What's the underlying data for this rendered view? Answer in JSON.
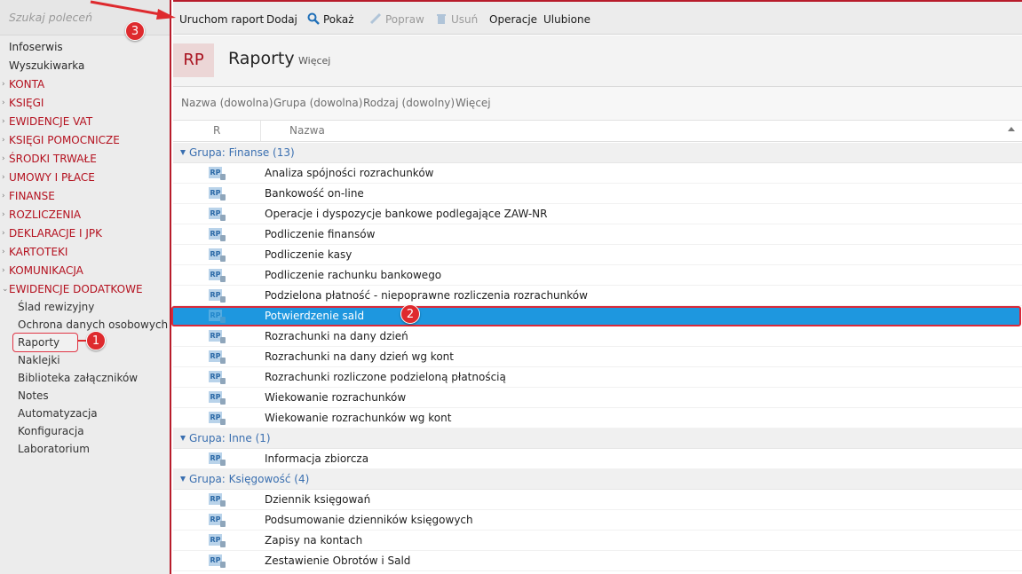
{
  "search": {
    "placeholder": "Szukaj poleceń"
  },
  "sidebar": {
    "items": [
      {
        "label": "Infoserwis",
        "kind": "plain"
      },
      {
        "label": "Wyszukiwarka",
        "kind": "plain"
      },
      {
        "label": "KONTA",
        "kind": "section"
      },
      {
        "label": "KSIĘGI",
        "kind": "section"
      },
      {
        "label": "EWIDENCJE VAT",
        "kind": "section"
      },
      {
        "label": "KSIĘGI POMOCNICZE",
        "kind": "section"
      },
      {
        "label": "ŚRODKI TRWAŁE",
        "kind": "section"
      },
      {
        "label": "UMOWY I PŁACE",
        "kind": "section"
      },
      {
        "label": "FINANSE",
        "kind": "section"
      },
      {
        "label": "ROZLICZENIA",
        "kind": "section"
      },
      {
        "label": "DEKLARACJE I JPK",
        "kind": "section"
      },
      {
        "label": "KARTOTEKI",
        "kind": "section"
      },
      {
        "label": "KOMUNIKACJA",
        "kind": "section"
      },
      {
        "label": "EWIDENCJE DODATKOWE",
        "kind": "section-open"
      }
    ],
    "subitems": [
      "Ślad rewizyjny",
      "Ochrona danych osobowych",
      "Raporty",
      "Naklejki",
      "Biblioteka załączników",
      "Notes",
      "Automatyzacja",
      "Konfiguracja",
      "Laboratorium"
    ]
  },
  "toolbar": {
    "run_label": "Uruchom raport",
    "add_label": "Dodaj",
    "show_label": "Pokaż",
    "edit_label": "Popraw",
    "delete_label": "Usuń",
    "operations_label": "Operacje",
    "favorites_label": "Ulubione"
  },
  "header": {
    "badge": "RP",
    "title": "Raporty",
    "more": "Więcej"
  },
  "filters": {
    "name": "Nazwa (dowolna)",
    "group": "Grupa (dowolna)",
    "kind": "Rodzaj (dowolny)",
    "more": "Więcej"
  },
  "columns": {
    "r": "R",
    "name": "Nazwa"
  },
  "row_icon_text": "RP",
  "groups": [
    {
      "label": "Grupa: Finanse (13)",
      "rows": [
        "Analiza spójności rozrachunków",
        "Bankowość on-line",
        "Operacje i dyspozycje bankowe podlegające ZAW-NR",
        "Podliczenie finansów",
        "Podliczenie kasy",
        "Podliczenie rachunku bankowego",
        "Podzielona płatność - niepoprawne rozliczenia rozrachunków",
        "Potwierdzenie sald",
        "Rozrachunki na dany dzień",
        "Rozrachunki na dany dzień wg kont",
        "Rozrachunki rozliczone podzieloną płatnością",
        "Wiekowanie rozrachunków",
        "Wiekowanie rozrachunków wg kont"
      ]
    },
    {
      "label": "Grupa: Inne (1)",
      "rows": [
        "Informacja zbiorcza"
      ]
    },
    {
      "label": "Grupa: Księgowość (4)",
      "rows": [
        "Dziennik księgowań",
        "Podsumowanie dzienników księgowych",
        "Zapisy na kontach",
        "Zestawienie Obrotów i Sald"
      ]
    }
  ],
  "selected_row": "Potwierdzenie sald",
  "markers": [
    "1",
    "2",
    "3"
  ],
  "colors": {
    "accent_red": "#b81c2b",
    "selection_blue": "#1e97df",
    "group_blue": "#3a6fb0",
    "marker_red": "#de2a2e"
  }
}
